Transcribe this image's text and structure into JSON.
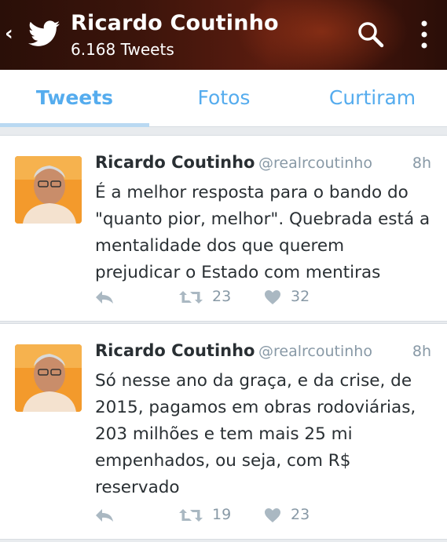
{
  "header": {
    "back_glyph": "‹",
    "name": "Ricardo Coutinho",
    "tweet_count": "6.168 Tweets",
    "icons": [
      "back-icon",
      "twitter-bird-icon",
      "search-icon",
      "more-vertical-icon"
    ]
  },
  "tabs": [
    {
      "label": "Tweets",
      "active": true
    },
    {
      "label": "Fotos",
      "active": false
    },
    {
      "label": "Curtiram",
      "active": false
    }
  ],
  "tweets": [
    {
      "name": "Ricardo Coutinho",
      "handle": "@realrcoutinho",
      "time": "8h",
      "text": "É a melhor resposta para o bando do \"quanto pior, melhor\". Quebrada está a mentalidade dos que querem prejudicar o Estado com mentiras",
      "retweets": "23",
      "likes": "32"
    },
    {
      "name": "Ricardo Coutinho",
      "handle": "@realrcoutinho",
      "time": "8h",
      "text": "Só nesse ano da graça, e da crise, de 2015, pagamos em obras rodoviárias, 203 milhões e tem mais 25 mi empenhados, ou seja, com R$ reservado",
      "retweets": "19",
      "likes": "23"
    }
  ],
  "colors": {
    "accent": "#55acee",
    "text": "#292f33",
    "muted": "#8899a6",
    "background": "#e8ebee"
  }
}
